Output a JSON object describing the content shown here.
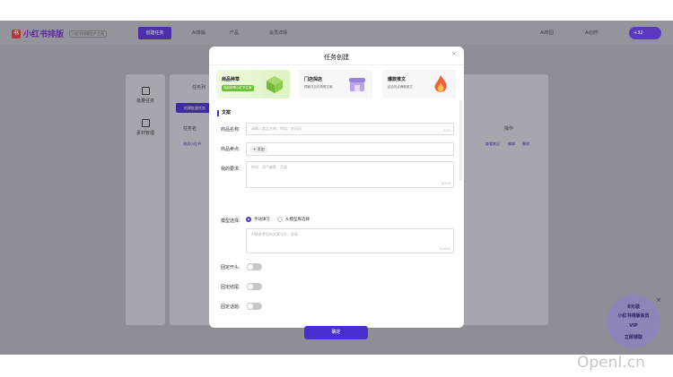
{
  "app": {
    "logo_mark": "书",
    "logo_text": "小红书排版",
    "logo_tag": "小红书排版生产工具",
    "active_nav": "创建任务",
    "nav": [
      "AI排版",
      "产品",
      "会员详情"
    ],
    "nav_right": [
      "AI校园",
      "AI创作"
    ],
    "user_badge": "+32"
  },
  "background": {
    "sidebar": [
      "批量任务",
      "素材管理"
    ],
    "tabs": [
      "任务列",
      "任务名称"
    ],
    "create_button": "创建批量任务",
    "table_headers": [
      "任务名",
      "操作"
    ],
    "row_name": "测试小红书",
    "row_actions": [
      "查看笔记",
      "编辑",
      "删除"
    ],
    "promo_lines": [
      "0元领",
      "小红书排版会员",
      "VIP",
      "立即领取"
    ]
  },
  "modal": {
    "title": "任务创建",
    "cards": [
      {
        "title": "商品种草",
        "subtitle": "商品种草小红书文案"
      },
      {
        "title": "门店探店",
        "subtitle": "顾客在店内拍照文案"
      },
      {
        "title": "爆款推文",
        "subtitle": "结合热点爆款推文"
      }
    ],
    "section": "文案",
    "fields": {
      "product_name": {
        "label": "商品名称:",
        "placeholder": "请输入商品名称，例如：吃风机",
        "counter": "0/20"
      },
      "selling_points": {
        "label": "商品卖点:",
        "add": "+ 添加"
      },
      "requirement": {
        "label": "我的要求:",
        "placeholder": "例如：语气幽默、活泼",
        "counter": "0/200"
      },
      "model": {
        "label": "模型选择:",
        "options": [
          "手动填写",
          "从模型库选择"
        ],
        "placeholder": "AI将参考您的文案写作，选填",
        "counter": "0/1000"
      },
      "fixed_start": {
        "label": "固定开头:"
      },
      "fixed_end": {
        "label": "固定结尾:"
      },
      "fixed_tags": {
        "label": "固定话题:"
      }
    },
    "confirm": "确定"
  },
  "watermark": "OpenI.cn",
  "colors": {
    "accent": "#4a2fd0",
    "overlay": "#8e8e96",
    "active_card": "#dff3c4"
  }
}
